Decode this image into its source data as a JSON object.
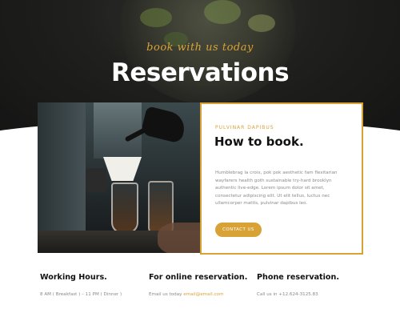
{
  "hero": {
    "tagline": "book with us today",
    "title": "Reservations"
  },
  "booking": {
    "kicker": "PULVINAR DAPIBUS",
    "title": "How to book.",
    "body": "Humblebrag la croix, pok pok aesthetic fam flexitarian wayfarers health goth sustainable try-hard brooklyn authentic live-edge. Lorem ipsum dolor sit amet, consectetur adipiscing elit. Ut elit tellus, luctus nec ullamcorper mattis, pulvinar dapibus leo.",
    "cta_label": "CONTACT US"
  },
  "info": {
    "hours": {
      "title": "Working Hours.",
      "text": "8 AM ( Breakfast ) – 11 PM ( Dinner )"
    },
    "online": {
      "title": "For online reservation.",
      "text_prefix": "Email us today ",
      "email": "email@email.com"
    },
    "phone": {
      "title": "Phone reservation.",
      "text": "Call us in +12.624-3125.83"
    }
  },
  "colors": {
    "accent": "#d9a236",
    "heading": "#111111",
    "body_text": "#8a8a8a"
  }
}
